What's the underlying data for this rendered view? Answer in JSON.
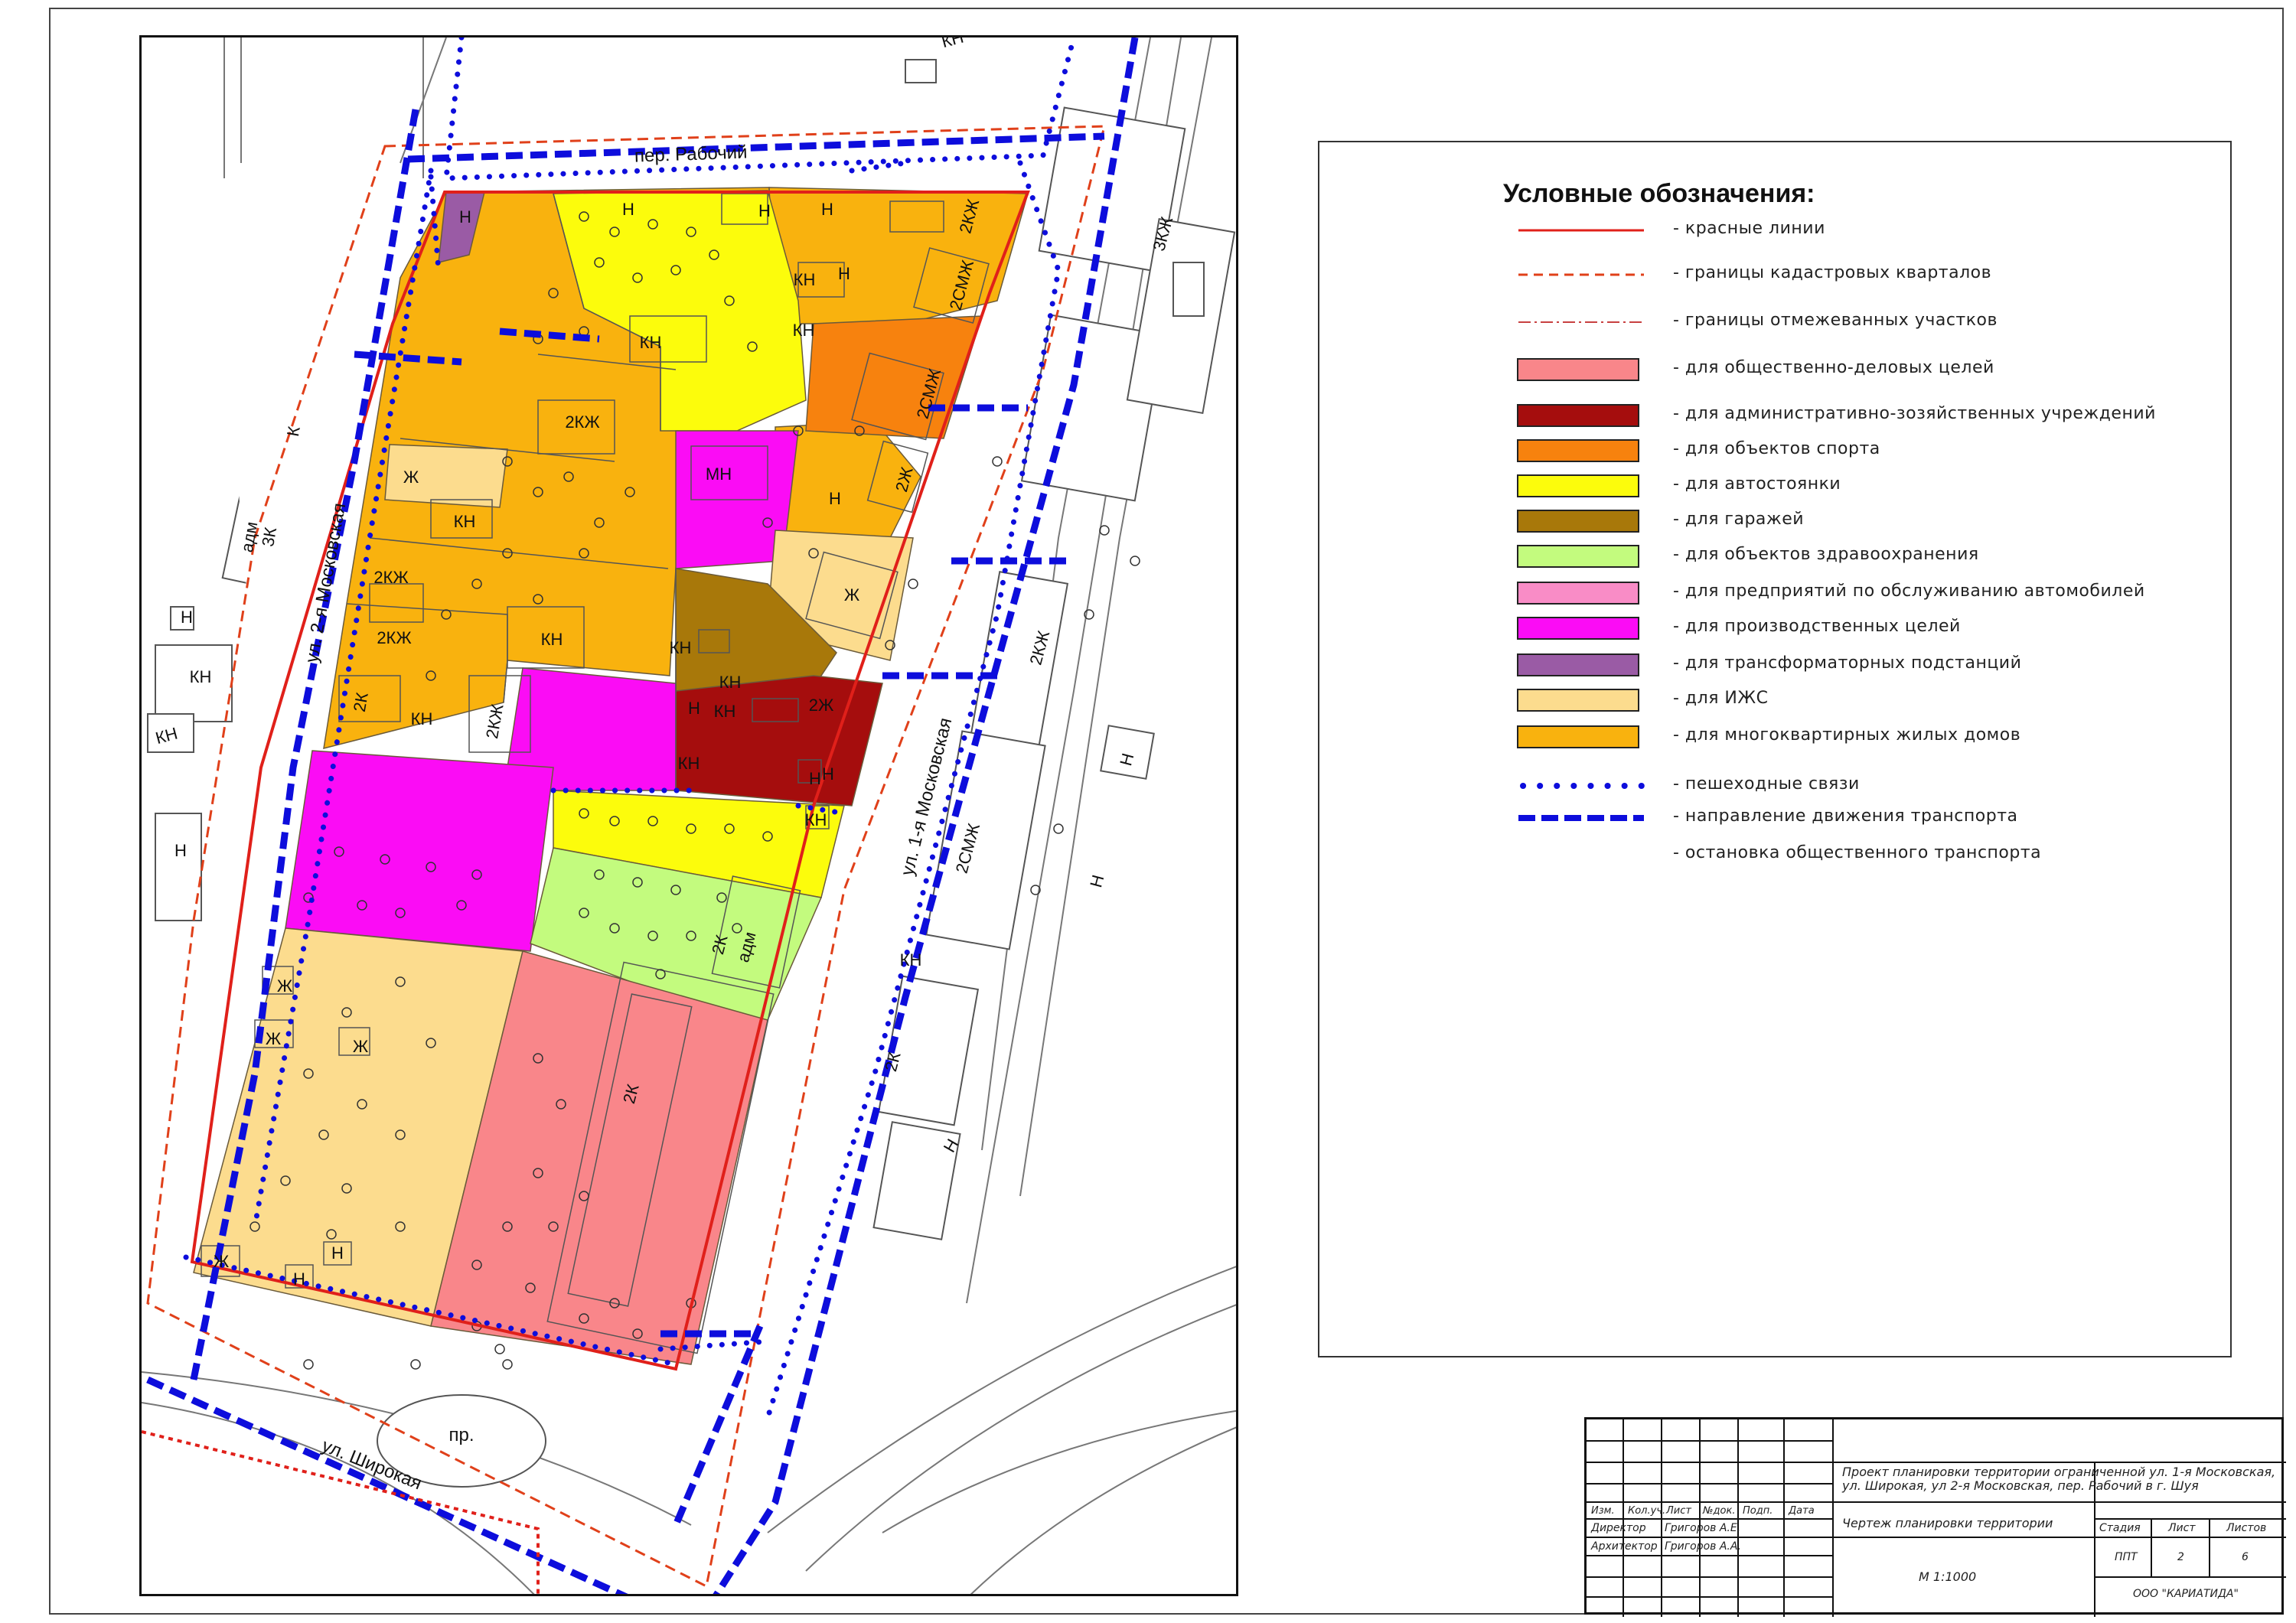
{
  "map": {
    "streets": {
      "rabochiy": "пер. Рабочий",
      "moskovskaya_2": "ул. 2-я Московская",
      "moskovskaya_1": "ул. 1-я Московская",
      "shirokaya": "ул. Широкая"
    },
    "other_labels": {
      "pr": "пр.",
      "adm_3k": "адм\n3К"
    },
    "building_labels": [
      "Н",
      "Н",
      "Н",
      "Н",
      "Н",
      "2КЖ",
      "2СМЖ",
      "КН",
      "КН",
      "КН",
      "2КЖ",
      "2СМЖ",
      "МН",
      "Ж",
      "КН",
      "2КЖ",
      "2Ж",
      "Н",
      "Ж",
      "2КЖ",
      "КН",
      "КН",
      "2К",
      "КН",
      "2КЖ",
      "КН",
      "Н",
      "КН",
      "2Ж",
      "Н",
      "КН",
      "Н",
      "КН",
      "2К",
      "адм",
      "Ж",
      "Ж",
      "Ж",
      "2К",
      "Ж",
      "Н",
      "Н",
      "2К",
      "КН",
      "3КЖ",
      "К",
      "Н",
      "КН",
      "КН",
      "Н",
      "2КЖ",
      "2СМЖ",
      "Н",
      "Н",
      "КН",
      "Н"
    ]
  },
  "legend": {
    "title": "Условные обозначения:",
    "items": [
      {
        "kind": "line-solid",
        "color": "#e0201a",
        "label": "- красные линии"
      },
      {
        "kind": "line-dashed",
        "color": "#e0401a",
        "label": "- границы кадастровых кварталов"
      },
      {
        "kind": "line-dashdot",
        "color": "#c84040",
        "label": "- границы отмежеванных участков"
      },
      {
        "kind": "swatch",
        "color": "#f9868a",
        "label": "- для общественно-деловых целей"
      },
      {
        "kind": "swatch",
        "color": "#a50d0d",
        "label": "- для административно-зозяйственных учреждений"
      },
      {
        "kind": "swatch",
        "color": "#f7820e",
        "label": "- для объектов спорта"
      },
      {
        "kind": "swatch",
        "color": "#fcfc0c",
        "label": "- для автостоянки"
      },
      {
        "kind": "swatch",
        "color": "#a8780a",
        "label": "- для гаражей"
      },
      {
        "kind": "swatch",
        "color": "#c3fb7e",
        "label": "- для объектов здравоохранения"
      },
      {
        "kind": "swatch",
        "color": "#f98cc6",
        "label": "- для предприятий по обслуживанию автомобилей"
      },
      {
        "kind": "swatch",
        "color": "#fb0cf5",
        "label": "- для производственных целей"
      },
      {
        "kind": "swatch",
        "color": "#9a5ba5",
        "label": "- для трансформаторных подстанций"
      },
      {
        "kind": "swatch",
        "color": "#fcdc8e",
        "label": "- для ИЖС"
      },
      {
        "kind": "swatch",
        "color": "#f9b20e",
        "label": "- для многоквартирных жилых домов"
      },
      {
        "kind": "dots",
        "color": "#0d0ddc",
        "label": "- пешеходные связи"
      },
      {
        "kind": "dashes",
        "color": "#0d0ddc",
        "label": "- направление движения транспорта"
      },
      {
        "kind": "none",
        "color": "",
        "label": "- остановка общественного транспорта"
      }
    ]
  },
  "stamp": {
    "project_title": "Проект планировки территории ограниченной ул. 1-я Московская,\nул. Широкая, ул 2-я Московская, пер. Рабочий в г. Шуя",
    "columns": [
      "Изм.",
      "Кол.уч.",
      "Лист",
      "№док.",
      "Подп.",
      "Дата"
    ],
    "roles": [
      {
        "role": "Директор",
        "name": "Григоров А.Е."
      },
      {
        "role": "Архитектор",
        "name": "Григоров А.А."
      }
    ],
    "sheet_title": "Чертеж планировки территории",
    "stage_header": "Стадия",
    "sheet_header": "Лист",
    "sheets_header": "Листов",
    "stage": "ППТ",
    "sheet": "2",
    "sheets": "6",
    "scale": "М 1:1000",
    "company": "ООО \"КАРИАТИДА\""
  }
}
